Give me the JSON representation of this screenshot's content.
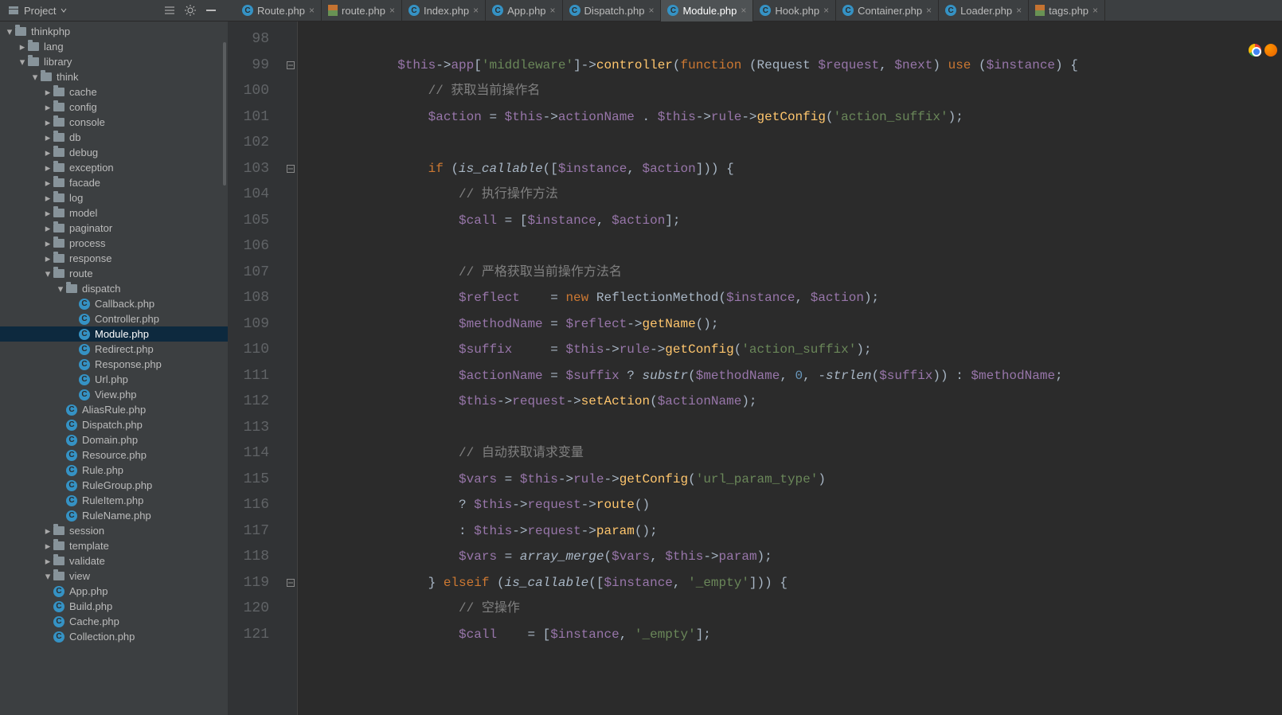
{
  "projectLabel": "Project",
  "tabs": [
    {
      "label": "Route.php",
      "icon": "cblue",
      "active": false
    },
    {
      "label": "route.php",
      "icon": "lg",
      "active": false
    },
    {
      "label": "Index.php",
      "icon": "cblue",
      "active": false
    },
    {
      "label": "App.php",
      "icon": "cblue",
      "active": false
    },
    {
      "label": "Dispatch.php",
      "icon": "cblue",
      "active": false
    },
    {
      "label": "Module.php",
      "icon": "cblue",
      "active": true
    },
    {
      "label": "Hook.php",
      "icon": "cblue",
      "active": false
    },
    {
      "label": "Container.php",
      "icon": "cblue",
      "active": false
    },
    {
      "label": "Loader.php",
      "icon": "cblue",
      "active": false
    },
    {
      "label": "tags.php",
      "icon": "lg",
      "active": false
    }
  ],
  "tree": [
    {
      "depth": 0,
      "arrow": "down",
      "icon": "folder",
      "label": "thinkphp"
    },
    {
      "depth": 1,
      "arrow": "right",
      "icon": "folder",
      "label": "lang"
    },
    {
      "depth": 1,
      "arrow": "down",
      "icon": "folder",
      "label": "library"
    },
    {
      "depth": 2,
      "arrow": "down",
      "icon": "folder",
      "label": "think"
    },
    {
      "depth": 3,
      "arrow": "right",
      "icon": "folder",
      "label": "cache"
    },
    {
      "depth": 3,
      "arrow": "right",
      "icon": "folder",
      "label": "config"
    },
    {
      "depth": 3,
      "arrow": "right",
      "icon": "folder",
      "label": "console"
    },
    {
      "depth": 3,
      "arrow": "right",
      "icon": "folder",
      "label": "db"
    },
    {
      "depth": 3,
      "arrow": "right",
      "icon": "folder",
      "label": "debug"
    },
    {
      "depth": 3,
      "arrow": "right",
      "icon": "folder",
      "label": "exception"
    },
    {
      "depth": 3,
      "arrow": "right",
      "icon": "folder",
      "label": "facade"
    },
    {
      "depth": 3,
      "arrow": "right",
      "icon": "folder",
      "label": "log"
    },
    {
      "depth": 3,
      "arrow": "right",
      "icon": "folder",
      "label": "model"
    },
    {
      "depth": 3,
      "arrow": "right",
      "icon": "folder",
      "label": "paginator"
    },
    {
      "depth": 3,
      "arrow": "right",
      "icon": "folder",
      "label": "process"
    },
    {
      "depth": 3,
      "arrow": "right",
      "icon": "folder",
      "label": "response"
    },
    {
      "depth": 3,
      "arrow": "down",
      "icon": "folder",
      "label": "route"
    },
    {
      "depth": 4,
      "arrow": "down",
      "icon": "folder",
      "label": "dispatch"
    },
    {
      "depth": 5,
      "arrow": "",
      "icon": "circle",
      "label": "Callback.php"
    },
    {
      "depth": 5,
      "arrow": "",
      "icon": "circle",
      "label": "Controller.php"
    },
    {
      "depth": 5,
      "arrow": "",
      "icon": "circle",
      "label": "Module.php",
      "selected": true
    },
    {
      "depth": 5,
      "arrow": "",
      "icon": "circle",
      "label": "Redirect.php"
    },
    {
      "depth": 5,
      "arrow": "",
      "icon": "circle",
      "label": "Response.php"
    },
    {
      "depth": 5,
      "arrow": "",
      "icon": "circle",
      "label": "Url.php"
    },
    {
      "depth": 5,
      "arrow": "",
      "icon": "circle",
      "label": "View.php"
    },
    {
      "depth": 4,
      "arrow": "",
      "icon": "circle",
      "label": "AliasRule.php"
    },
    {
      "depth": 4,
      "arrow": "",
      "icon": "circle",
      "label": "Dispatch.php"
    },
    {
      "depth": 4,
      "arrow": "",
      "icon": "circle",
      "label": "Domain.php"
    },
    {
      "depth": 4,
      "arrow": "",
      "icon": "circle",
      "label": "Resource.php"
    },
    {
      "depth": 4,
      "arrow": "",
      "icon": "circle",
      "label": "Rule.php"
    },
    {
      "depth": 4,
      "arrow": "",
      "icon": "circle",
      "label": "RuleGroup.php"
    },
    {
      "depth": 4,
      "arrow": "",
      "icon": "circle",
      "label": "RuleItem.php"
    },
    {
      "depth": 4,
      "arrow": "",
      "icon": "circle",
      "label": "RuleName.php"
    },
    {
      "depth": 3,
      "arrow": "right",
      "icon": "folder",
      "label": "session"
    },
    {
      "depth": 3,
      "arrow": "right",
      "icon": "folder",
      "label": "template"
    },
    {
      "depth": 3,
      "arrow": "right",
      "icon": "folder",
      "label": "validate"
    },
    {
      "depth": 3,
      "arrow": "down",
      "icon": "folder",
      "label": "view"
    },
    {
      "depth": 3,
      "arrow": "",
      "icon": "circle",
      "label": "App.php"
    },
    {
      "depth": 3,
      "arrow": "",
      "icon": "circle",
      "label": "Build.php"
    },
    {
      "depth": 3,
      "arrow": "",
      "icon": "circle",
      "label": "Cache.php"
    },
    {
      "depth": 3,
      "arrow": "",
      "icon": "circle",
      "label": "Collection.php"
    }
  ],
  "lineStart": 98,
  "lineEnd": 121,
  "folds": {
    "99": "minus",
    "103": "minus",
    "119": "minus"
  },
  "code": {
    "98": [
      {
        "t": "",
        "c": ""
      }
    ],
    "99": [
      {
        "t": "            ",
        "c": ""
      },
      {
        "t": "$this",
        "c": "tok-var"
      },
      {
        "t": "->",
        "c": ""
      },
      {
        "t": "app",
        "c": "tok-var"
      },
      {
        "t": "[",
        "c": ""
      },
      {
        "t": "'middleware'",
        "c": "tok-string"
      },
      {
        "t": "]->",
        "c": ""
      },
      {
        "t": "controller",
        "c": "tok-callf"
      },
      {
        "t": "(",
        "c": ""
      },
      {
        "t": "function ",
        "c": "tok-keyword"
      },
      {
        "t": "(Request ",
        "c": ""
      },
      {
        "t": "$request",
        "c": "tok-var"
      },
      {
        "t": ", ",
        "c": ""
      },
      {
        "t": "$next",
        "c": "tok-var"
      },
      {
        "t": ") ",
        "c": ""
      },
      {
        "t": "use ",
        "c": "tok-keyword"
      },
      {
        "t": "(",
        "c": ""
      },
      {
        "t": "$instance",
        "c": "tok-var"
      },
      {
        "t": ") {",
        "c": ""
      }
    ],
    "100": [
      {
        "t": "                ",
        "c": ""
      },
      {
        "t": "// 获取当前操作名",
        "c": "tok-comment"
      }
    ],
    "101": [
      {
        "t": "                ",
        "c": ""
      },
      {
        "t": "$action",
        "c": "tok-var"
      },
      {
        "t": " = ",
        "c": ""
      },
      {
        "t": "$this",
        "c": "tok-var"
      },
      {
        "t": "->",
        "c": ""
      },
      {
        "t": "actionName",
        "c": "tok-var"
      },
      {
        "t": " . ",
        "c": ""
      },
      {
        "t": "$this",
        "c": "tok-var"
      },
      {
        "t": "->",
        "c": ""
      },
      {
        "t": "rule",
        "c": "tok-var"
      },
      {
        "t": "->",
        "c": ""
      },
      {
        "t": "getConfig",
        "c": "tok-callf"
      },
      {
        "t": "(",
        "c": ""
      },
      {
        "t": "'action_suffix'",
        "c": "tok-string"
      },
      {
        "t": ");",
        "c": ""
      }
    ],
    "102": [
      {
        "t": "",
        "c": ""
      }
    ],
    "103": [
      {
        "t": "                ",
        "c": ""
      },
      {
        "t": "if ",
        "c": "tok-keyword"
      },
      {
        "t": "(",
        "c": ""
      },
      {
        "t": "is_callable",
        "c": "tok-italic"
      },
      {
        "t": "([",
        "c": ""
      },
      {
        "t": "$instance",
        "c": "tok-var"
      },
      {
        "t": ", ",
        "c": ""
      },
      {
        "t": "$action",
        "c": "tok-var"
      },
      {
        "t": "])) {",
        "c": ""
      }
    ],
    "104": [
      {
        "t": "                    ",
        "c": ""
      },
      {
        "t": "// 执行操作方法",
        "c": "tok-comment"
      }
    ],
    "105": [
      {
        "t": "                    ",
        "c": ""
      },
      {
        "t": "$call",
        "c": "tok-var"
      },
      {
        "t": " = [",
        "c": ""
      },
      {
        "t": "$instance",
        "c": "tok-var"
      },
      {
        "t": ", ",
        "c": ""
      },
      {
        "t": "$action",
        "c": "tok-var"
      },
      {
        "t": "];",
        "c": ""
      }
    ],
    "106": [
      {
        "t": "",
        "c": ""
      }
    ],
    "107": [
      {
        "t": "                    ",
        "c": ""
      },
      {
        "t": "// 严格获取当前操作方法名",
        "c": "tok-comment"
      }
    ],
    "108": [
      {
        "t": "                    ",
        "c": ""
      },
      {
        "t": "$reflect",
        "c": "tok-var"
      },
      {
        "t": "    = ",
        "c": ""
      },
      {
        "t": "new ",
        "c": "tok-keyword"
      },
      {
        "t": "ReflectionMethod(",
        "c": ""
      },
      {
        "t": "$instance",
        "c": "tok-var"
      },
      {
        "t": ", ",
        "c": ""
      },
      {
        "t": "$action",
        "c": "tok-var"
      },
      {
        "t": ");",
        "c": ""
      }
    ],
    "109": [
      {
        "t": "                    ",
        "c": ""
      },
      {
        "t": "$methodName",
        "c": "tok-var"
      },
      {
        "t": " = ",
        "c": ""
      },
      {
        "t": "$reflect",
        "c": "tok-var"
      },
      {
        "t": "->",
        "c": ""
      },
      {
        "t": "getName",
        "c": "tok-callf"
      },
      {
        "t": "();",
        "c": ""
      }
    ],
    "110": [
      {
        "t": "                    ",
        "c": ""
      },
      {
        "t": "$suffix",
        "c": "tok-var"
      },
      {
        "t": "     = ",
        "c": ""
      },
      {
        "t": "$this",
        "c": "tok-var"
      },
      {
        "t": "->",
        "c": ""
      },
      {
        "t": "rule",
        "c": "tok-var"
      },
      {
        "t": "->",
        "c": ""
      },
      {
        "t": "getConfig",
        "c": "tok-callf"
      },
      {
        "t": "(",
        "c": ""
      },
      {
        "t": "'action_suffix'",
        "c": "tok-string"
      },
      {
        "t": ");",
        "c": ""
      }
    ],
    "111": [
      {
        "t": "                    ",
        "c": ""
      },
      {
        "t": "$actionName",
        "c": "tok-var"
      },
      {
        "t": " = ",
        "c": ""
      },
      {
        "t": "$suffix",
        "c": "tok-var"
      },
      {
        "t": " ? ",
        "c": ""
      },
      {
        "t": "substr",
        "c": "tok-italic"
      },
      {
        "t": "(",
        "c": ""
      },
      {
        "t": "$methodName",
        "c": "tok-var"
      },
      {
        "t": ", ",
        "c": ""
      },
      {
        "t": "0",
        "c": "tok-num"
      },
      {
        "t": ", -",
        "c": ""
      },
      {
        "t": "strlen",
        "c": "tok-italic"
      },
      {
        "t": "(",
        "c": ""
      },
      {
        "t": "$suffix",
        "c": "tok-var"
      },
      {
        "t": ")) : ",
        "c": ""
      },
      {
        "t": "$methodName",
        "c": "tok-var"
      },
      {
        "t": ";",
        "c": ""
      }
    ],
    "112": [
      {
        "t": "                    ",
        "c": ""
      },
      {
        "t": "$this",
        "c": "tok-var"
      },
      {
        "t": "->",
        "c": ""
      },
      {
        "t": "request",
        "c": "tok-var"
      },
      {
        "t": "->",
        "c": ""
      },
      {
        "t": "setAction",
        "c": "tok-callf"
      },
      {
        "t": "(",
        "c": ""
      },
      {
        "t": "$actionName",
        "c": "tok-var"
      },
      {
        "t": ");",
        "c": ""
      }
    ],
    "113": [
      {
        "t": "",
        "c": ""
      }
    ],
    "114": [
      {
        "t": "                    ",
        "c": ""
      },
      {
        "t": "// 自动获取请求变量",
        "c": "tok-comment"
      }
    ],
    "115": [
      {
        "t": "                    ",
        "c": ""
      },
      {
        "t": "$vars",
        "c": "tok-var"
      },
      {
        "t": " = ",
        "c": ""
      },
      {
        "t": "$this",
        "c": "tok-var"
      },
      {
        "t": "->",
        "c": ""
      },
      {
        "t": "rule",
        "c": "tok-var"
      },
      {
        "t": "->",
        "c": ""
      },
      {
        "t": "getConfig",
        "c": "tok-callf"
      },
      {
        "t": "(",
        "c": ""
      },
      {
        "t": "'url_param_type'",
        "c": "tok-string"
      },
      {
        "t": ")",
        "c": ""
      }
    ],
    "116": [
      {
        "t": "                    ? ",
        "c": ""
      },
      {
        "t": "$this",
        "c": "tok-var"
      },
      {
        "t": "->",
        "c": ""
      },
      {
        "t": "request",
        "c": "tok-var"
      },
      {
        "t": "->",
        "c": ""
      },
      {
        "t": "route",
        "c": "tok-callf"
      },
      {
        "t": "()",
        "c": ""
      }
    ],
    "117": [
      {
        "t": "                    : ",
        "c": ""
      },
      {
        "t": "$this",
        "c": "tok-var"
      },
      {
        "t": "->",
        "c": ""
      },
      {
        "t": "request",
        "c": "tok-var"
      },
      {
        "t": "->",
        "c": ""
      },
      {
        "t": "param",
        "c": "tok-callf"
      },
      {
        "t": "();",
        "c": ""
      }
    ],
    "118": [
      {
        "t": "                    ",
        "c": ""
      },
      {
        "t": "$vars",
        "c": "tok-var"
      },
      {
        "t": " = ",
        "c": ""
      },
      {
        "t": "array_merge",
        "c": "tok-italic"
      },
      {
        "t": "(",
        "c": ""
      },
      {
        "t": "$vars",
        "c": "tok-var"
      },
      {
        "t": ", ",
        "c": ""
      },
      {
        "t": "$this",
        "c": "tok-var"
      },
      {
        "t": "->",
        "c": ""
      },
      {
        "t": "param",
        "c": "tok-var"
      },
      {
        "t": ");",
        "c": ""
      }
    ],
    "119": [
      {
        "t": "                } ",
        "c": ""
      },
      {
        "t": "elseif ",
        "c": "tok-keyword"
      },
      {
        "t": "(",
        "c": ""
      },
      {
        "t": "is_callable",
        "c": "tok-italic"
      },
      {
        "t": "([",
        "c": ""
      },
      {
        "t": "$instance",
        "c": "tok-var"
      },
      {
        "t": ", ",
        "c": ""
      },
      {
        "t": "'_empty'",
        "c": "tok-string"
      },
      {
        "t": "])) {",
        "c": ""
      }
    ],
    "120": [
      {
        "t": "                    ",
        "c": ""
      },
      {
        "t": "// 空操作",
        "c": "tok-comment"
      }
    ],
    "121": [
      {
        "t": "                    ",
        "c": ""
      },
      {
        "t": "$call",
        "c": "tok-var"
      },
      {
        "t": "    = [",
        "c": ""
      },
      {
        "t": "$instance",
        "c": "tok-var"
      },
      {
        "t": ", ",
        "c": ""
      },
      {
        "t": "'_empty'",
        "c": "tok-string"
      },
      {
        "t": "];",
        "c": ""
      }
    ]
  }
}
